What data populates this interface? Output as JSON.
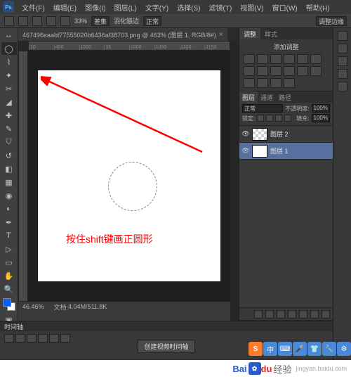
{
  "app": {
    "logo": "Ps"
  },
  "menu": [
    "文件(F)",
    "编辑(E)",
    "图像(I)",
    "图层(L)",
    "文字(Y)",
    "选择(S)",
    "滤镜(T)",
    "视图(V)",
    "窗口(W)",
    "帮助(H)"
  ],
  "optionbar": {
    "selmode": "差集",
    "feather_label": "羽化镞边",
    "mode_label": "正常",
    "adjust_btn": "调整边缘"
  },
  "doc": {
    "tab": "467496eaabf77555020b6436af38703.png @ 463% (图层 1, RGB/8#)",
    "ruler_h": [
      "10",
      "450",
      "1500",
      "15",
      "1000",
      "1050",
      "1100",
      "1150"
    ],
    "zoom": "46.46%",
    "docsize_label": "文档:",
    "docsize": "4.04M/511.8K"
  },
  "canvas": {
    "hint": "按住shift键画正圆形"
  },
  "panels": {
    "adjustments": {
      "tab": "调整",
      "styles": "样式",
      "title": "添加调整"
    },
    "layers": {
      "tabs": [
        "图层",
        "通道",
        "路径"
      ],
      "blend_label": "正常",
      "opacity_label": "不透明度:",
      "opacity": "100%",
      "lock_label": "锁定:",
      "fill_label": "填充:",
      "fill": "100%",
      "items": [
        {
          "name": "图层 2"
        },
        {
          "name": "图层 1"
        }
      ]
    }
  },
  "timeline": {
    "tab": "时间轴",
    "create": "创建视频时间轴"
  },
  "footer": {
    "baidu": "Bai",
    "du": "du",
    "jingyan": "经验",
    "url": "jingyan.baidu.com"
  },
  "overlay": {
    "s": "S",
    "zhong": "中"
  }
}
